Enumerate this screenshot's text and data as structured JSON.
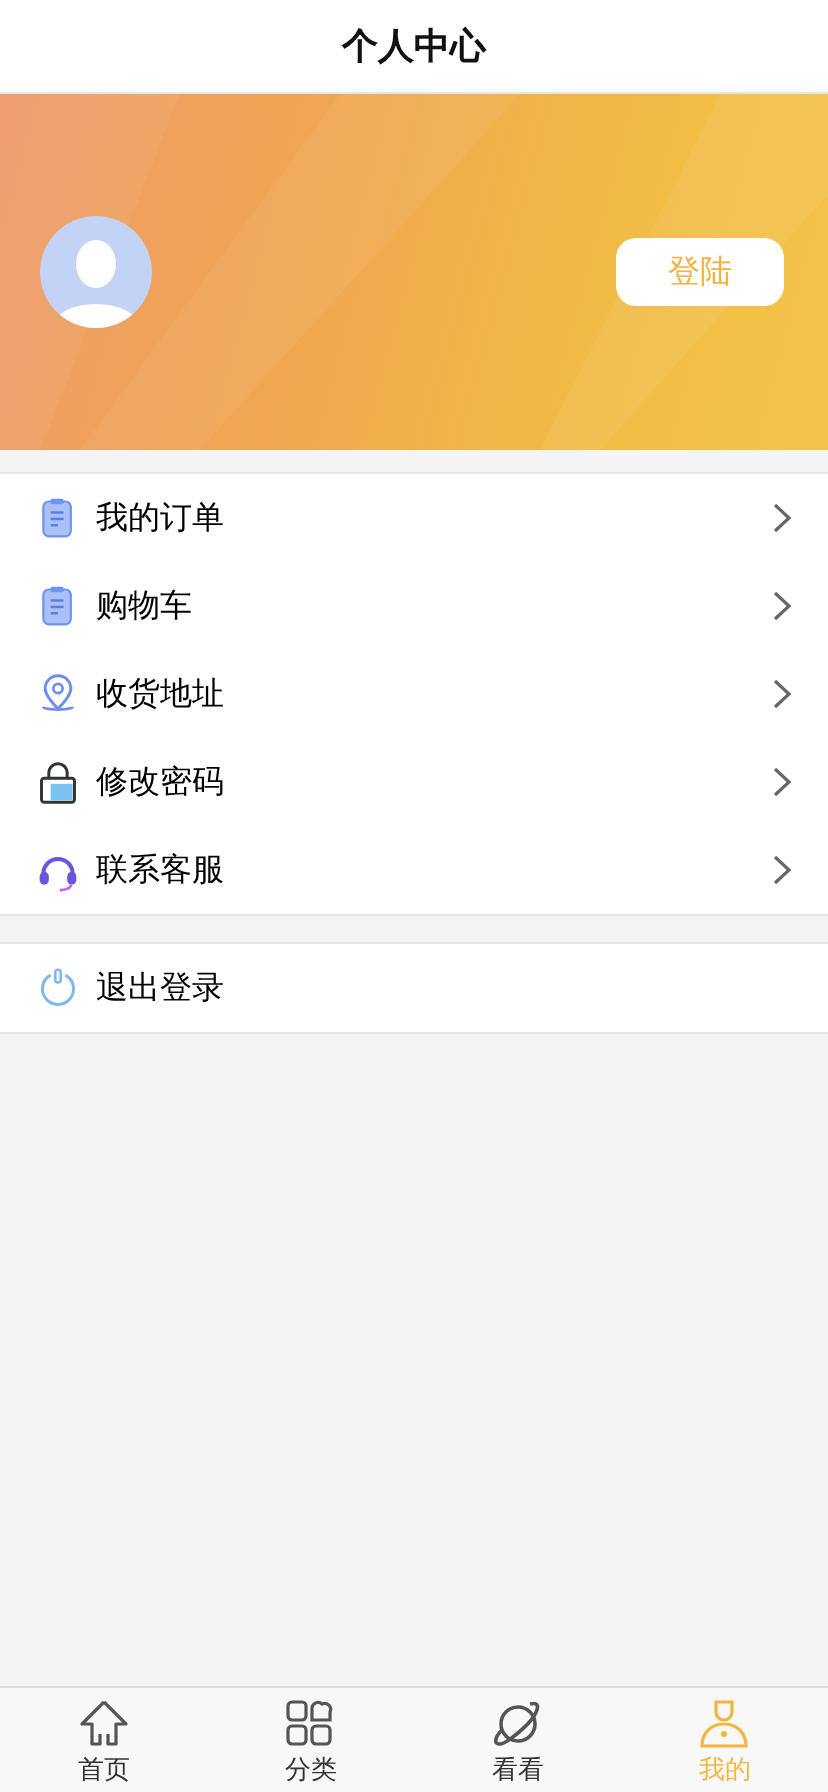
{
  "header": {
    "title": "个人中心"
  },
  "profile": {
    "login_button": "登陆"
  },
  "menu": [
    {
      "kind": "clipboard",
      "label": "我的订单"
    },
    {
      "kind": "clipboard",
      "label": "购物车"
    },
    {
      "kind": "pin",
      "label": "收货地址"
    },
    {
      "kind": "lock",
      "label": "修改密码"
    },
    {
      "kind": "headset",
      "label": "联系客服"
    }
  ],
  "logout": {
    "label": "退出登录"
  },
  "tab_bar": [
    {
      "kind": "home",
      "label": "首页",
      "selected": false
    },
    {
      "kind": "grid",
      "label": "分类",
      "selected": false
    },
    {
      "kind": "planet",
      "label": "看看",
      "selected": false
    },
    {
      "kind": "person",
      "label": "我的",
      "selected": true
    }
  ]
}
